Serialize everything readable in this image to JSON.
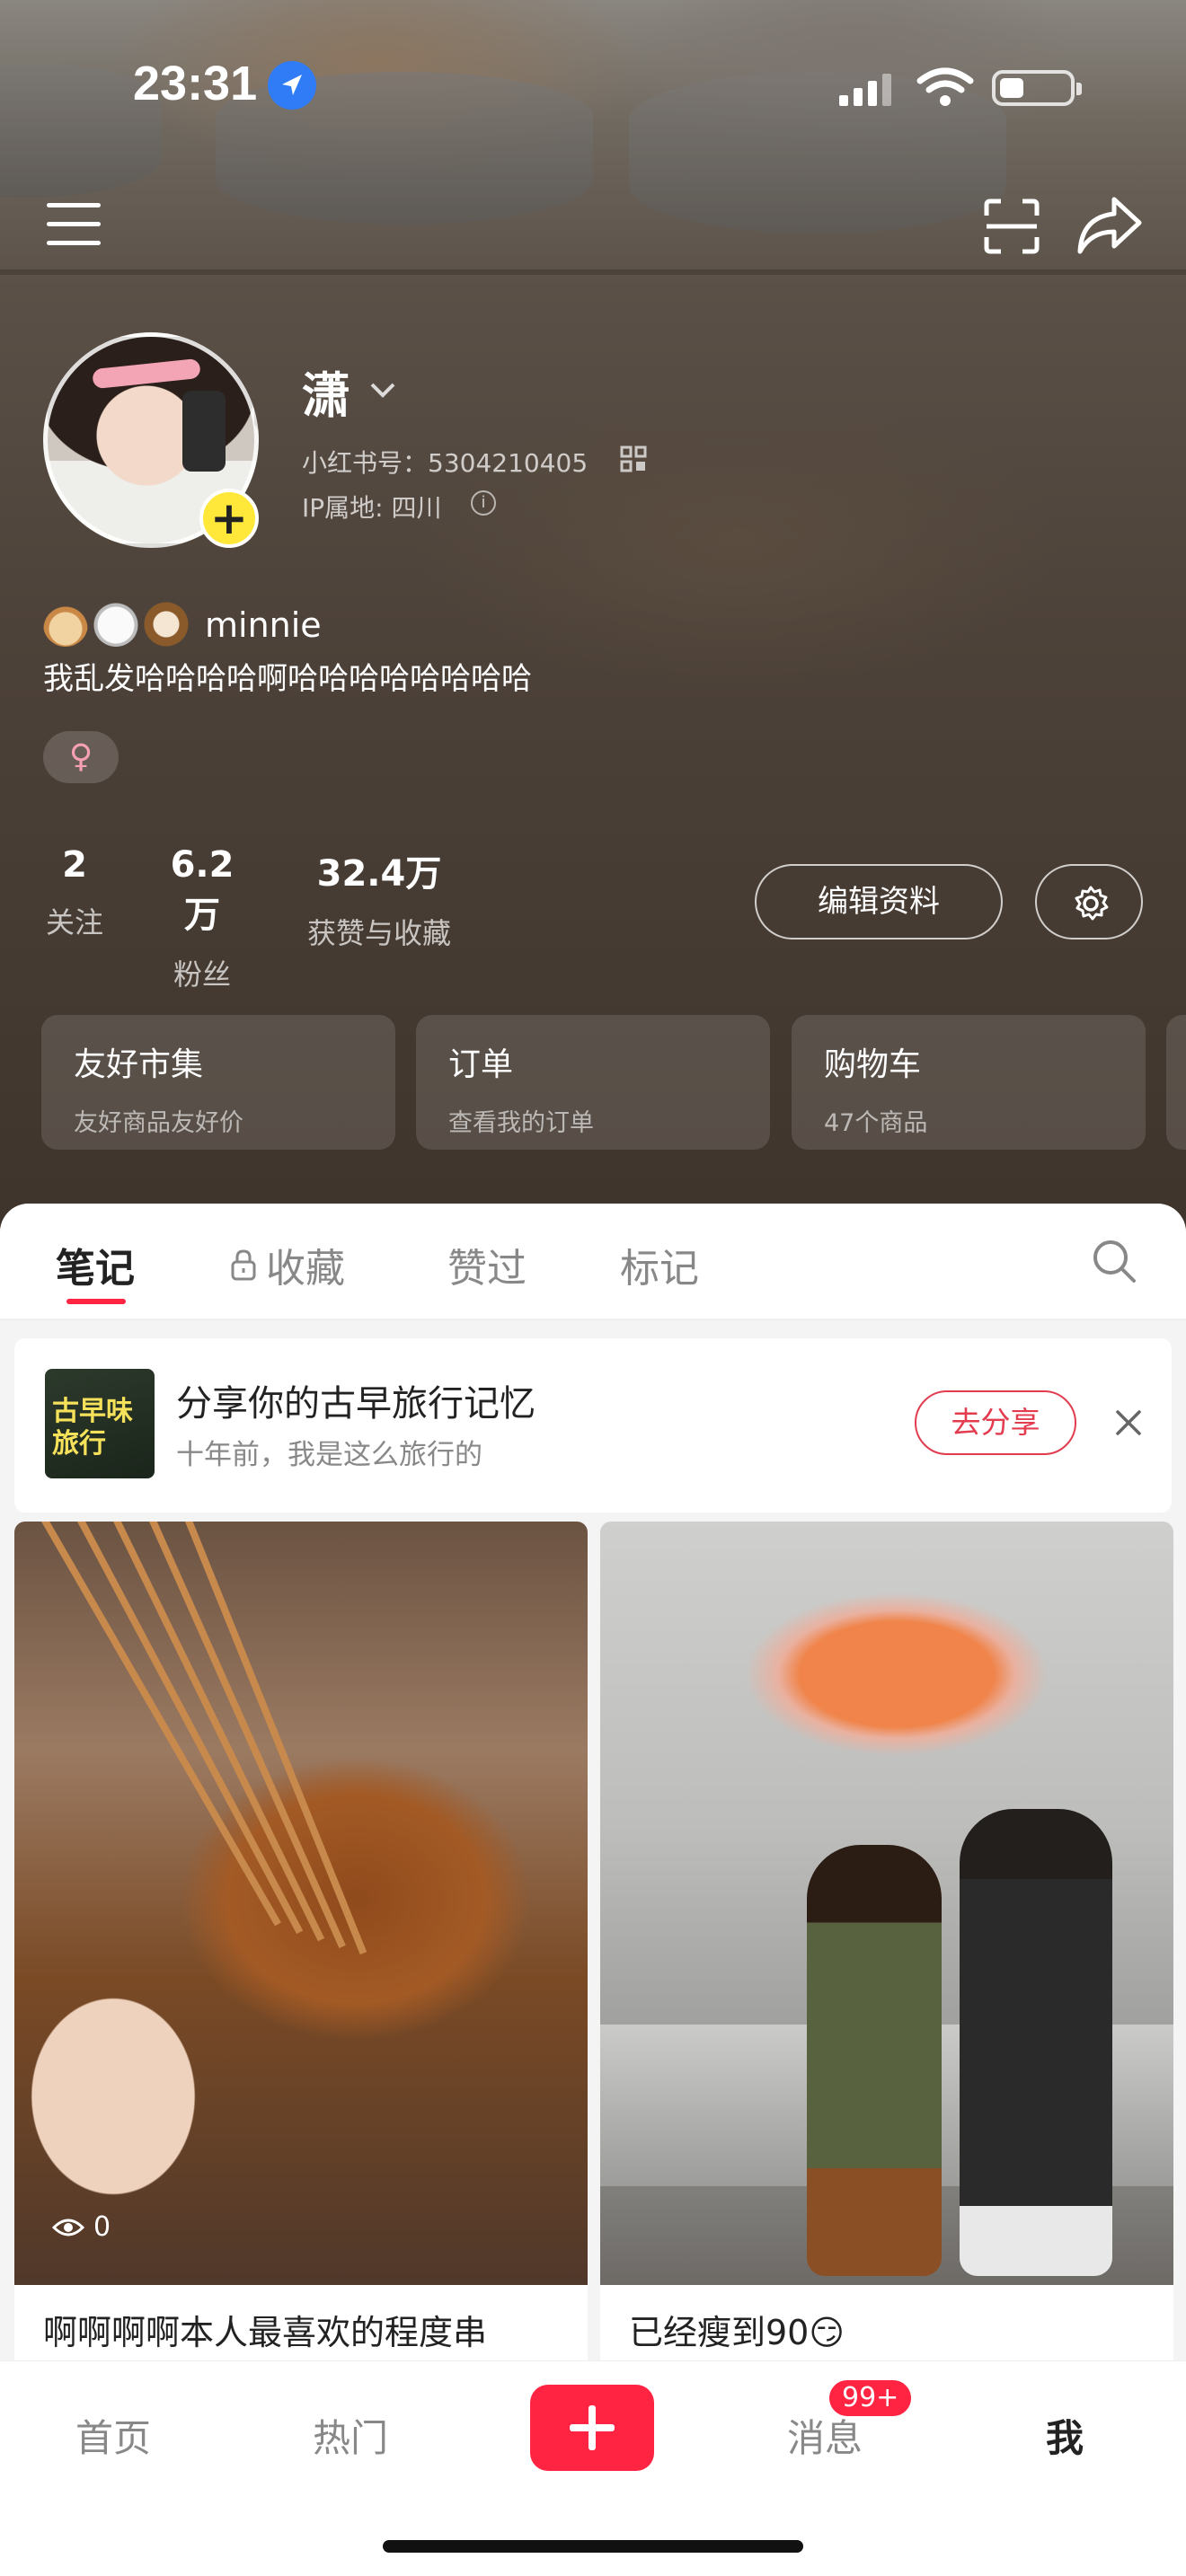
{
  "status_bar": {
    "time": "23:31"
  },
  "profile": {
    "username": "潇",
    "xhs_id": "小红书号：5304210405",
    "ip_location": "IP属地: 四川",
    "bio_name": "minnie",
    "bio_text": "我乱发哈哈哈哈啊哈哈哈哈哈哈哈哈",
    "gender": "♀"
  },
  "stats": [
    {
      "value": "2",
      "label": "关注"
    },
    {
      "value": "6.2万",
      "label": "粉丝"
    },
    {
      "value": "32.4万",
      "label": "获赞与收藏"
    }
  ],
  "buttons": {
    "edit_profile": "编辑资料"
  },
  "quick_cards": [
    {
      "title": "友好市集",
      "subtitle": "友好商品友好价"
    },
    {
      "title": "订单",
      "subtitle": "查看我的订单"
    },
    {
      "title": "购物车",
      "subtitle": "47个商品"
    }
  ],
  "tabs": [
    {
      "label": "笔记",
      "active": true
    },
    {
      "label": "收藏"
    },
    {
      "label": "赞过"
    },
    {
      "label": "标记"
    }
  ],
  "promo": {
    "thumb_text": "古早味旅行",
    "title": "分享你的古早旅行记忆",
    "subtitle": "十年前，我是这么旅行的",
    "button": "去分享"
  },
  "notes": [
    {
      "title": "啊啊啊啊本人最喜欢的程度串",
      "views": "0"
    },
    {
      "title": "已经瘦到90😏"
    }
  ],
  "tab_bar": {
    "home": "首页",
    "hot": "热门",
    "messages": "消息",
    "me": "我",
    "message_badge": "99+"
  },
  "colors": {
    "accent": "#ff2442"
  }
}
